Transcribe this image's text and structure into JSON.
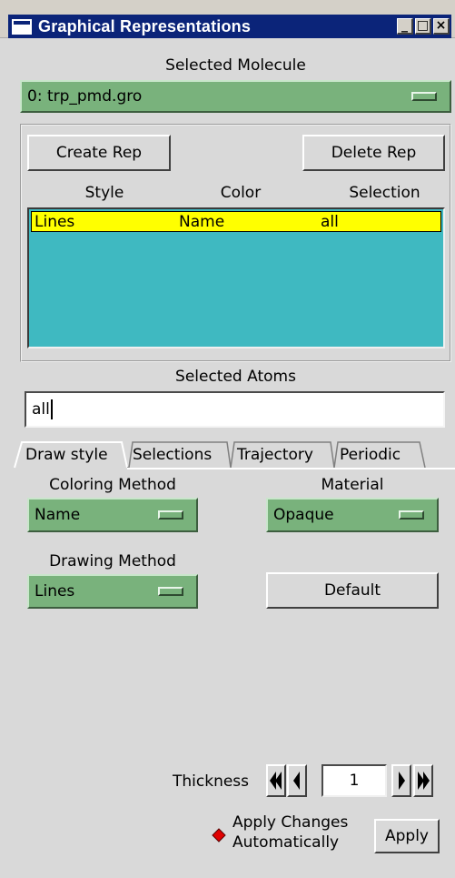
{
  "window": {
    "title": "Graphical Representations",
    "controls": [
      "_",
      "□",
      "×"
    ]
  },
  "molecule": {
    "label": "Selected Molecule",
    "selected": "0: trp_pmd.gro"
  },
  "reps": {
    "create_label": "Create Rep",
    "delete_label": "Delete Rep",
    "columns": [
      "Style",
      "Color",
      "Selection"
    ],
    "rows": [
      {
        "style": "Lines",
        "color": "Name",
        "selection": "all"
      }
    ]
  },
  "atoms": {
    "label": "Selected Atoms",
    "value": "all"
  },
  "tabs": [
    {
      "label": "Draw style",
      "active": true
    },
    {
      "label": "Selections",
      "active": false
    },
    {
      "label": "Trajectory",
      "active": false
    },
    {
      "label": "Periodic",
      "active": false
    }
  ],
  "draw_style": {
    "coloring_label": "Coloring Method",
    "coloring_value": "Name",
    "material_label": "Material",
    "material_value": "Opaque",
    "drawing_label": "Drawing Method",
    "drawing_value": "Lines",
    "default_label": "Default",
    "thickness_label": "Thickness",
    "thickness_value": "1"
  },
  "apply": {
    "auto_label_line1": "Apply Changes",
    "auto_label_line2": "Automatically",
    "auto_checked": true,
    "button_label": "Apply"
  },
  "colors": {
    "title_bar": "#0b2479",
    "window_bg": "#d9d9d9",
    "menu_green": "#79b27c",
    "list_bg": "#3fb9c1",
    "selected_row": "#ffff00",
    "radio_on": "#e00000"
  }
}
